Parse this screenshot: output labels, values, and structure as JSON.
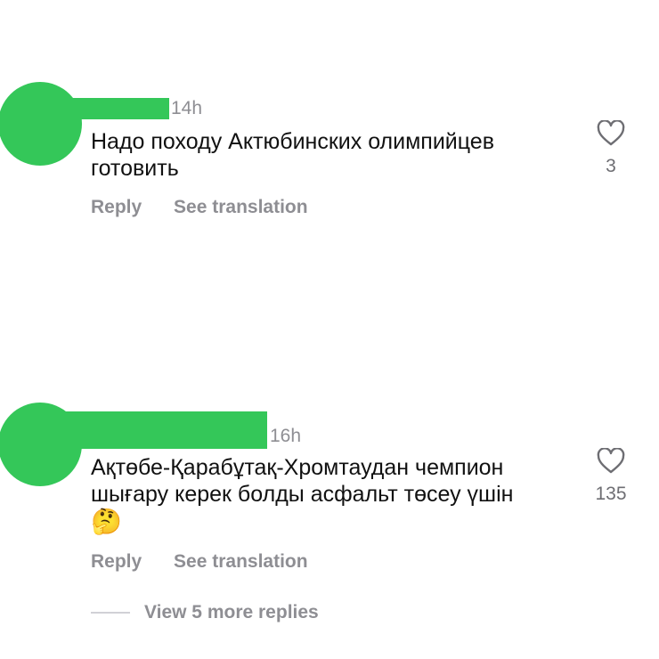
{
  "comments": [
    {
      "time": "14h",
      "text": "Надо походу Актюбинских олимпийцев\nготовить",
      "emoji": "",
      "like_count": "3",
      "reply_label": "Reply",
      "translate_label": "See translation"
    },
    {
      "time": "16h",
      "text": "Ақтөбе-Қарабұтақ-Хромтаудан чемпион\nшығару керек болды асфальт төсеу үшін",
      "emoji": "🤔",
      "like_count": "135",
      "reply_label": "Reply",
      "translate_label": "See translation"
    }
  ],
  "view_more_replies": "View 5 more replies",
  "colors": {
    "avatar_redaction": "#34c759",
    "secondary_text": "#8e8e93"
  },
  "icons": {
    "like": "heart-outline-icon"
  }
}
